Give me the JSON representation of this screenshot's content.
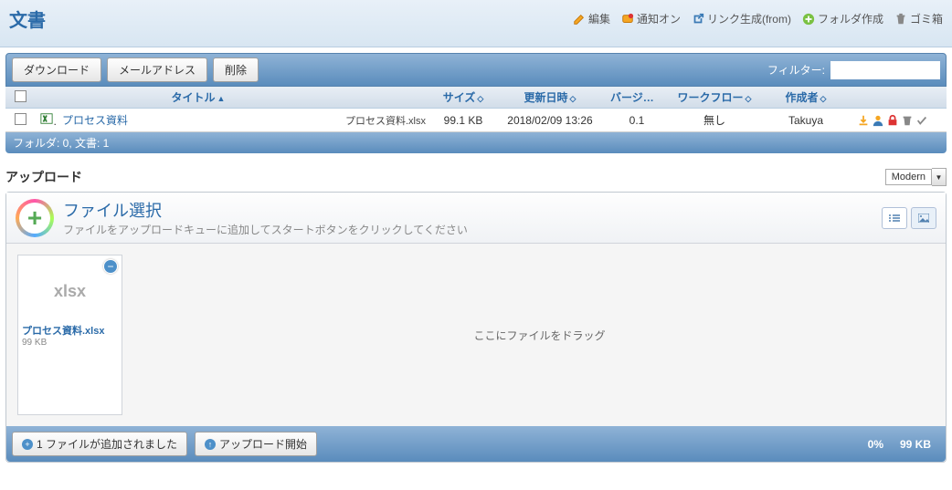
{
  "page": {
    "title": "文書"
  },
  "top_actions": {
    "edit": "編集",
    "notify": "通知オン",
    "link_gen": "リンク生成(from)",
    "folder_create": "フォルダ作成",
    "trash": "ゴミ箱"
  },
  "toolbar": {
    "download": "ダウンロード",
    "email": "メールアドレス",
    "delete": "削除",
    "filter_label": "フィルター:"
  },
  "grid": {
    "headers": {
      "title": "タイトル",
      "size": "サイズ",
      "update": "更新日時",
      "version": "バージョン",
      "workflow": "ワークフロー",
      "author": "作成者"
    },
    "rows": [
      {
        "title": "プロセス資料",
        "filename": "プロセス資料.xlsx",
        "size": "99.1 KB",
        "update": "2018/02/09 13:26",
        "version": "0.1",
        "workflow": "無し",
        "author": "Takuya"
      }
    ],
    "footer": "フォルダ: 0, 文書: 1"
  },
  "upload": {
    "section_title": "アップロード",
    "theme": "Modern",
    "select_label": "ファイル選択",
    "select_sub": "ファイルをアップロードキューに追加してスタートボタンをクリックしてください",
    "drop_msg": "ここにファイルをドラッグ",
    "file": {
      "ext": "xlsx",
      "name": "プロセス資料.xlsx",
      "size": "99 KB"
    },
    "footer": {
      "added": "1 ファイルが追加されました",
      "start": "アップロード開始",
      "percent": "0%",
      "total": "99 KB"
    }
  },
  "colors": {
    "accent": "#2a6aa8"
  }
}
